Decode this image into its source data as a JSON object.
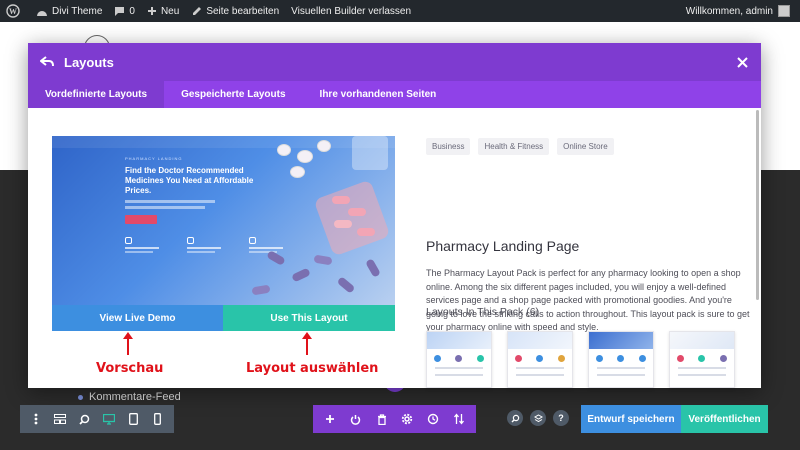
{
  "adminbar": {
    "site_name": "Divi Theme",
    "comments_count": "0",
    "new_label": "Neu",
    "edit_page": "Seite bearbeiten",
    "exit_builder": "Visuellen Builder verlassen",
    "welcome": "Willkommen, admin"
  },
  "modal": {
    "title": "Layouts",
    "tabs": [
      {
        "label": "Vordefinierte Layouts",
        "active": true
      },
      {
        "label": "Gespeicherte Layouts",
        "active": false
      },
      {
        "label": "Ihre vorhandenen Seiten",
        "active": false
      }
    ],
    "preview": {
      "kicker": "PHARMACY LANDING",
      "headline": "Find the Doctor Recommended Medicines You Need at Affordable Prices."
    },
    "view_demo_label": "View Live Demo",
    "use_layout_label": "Use This Layout",
    "tags": [
      "Business",
      "Health & Fitness",
      "Online Store"
    ],
    "layout_name": "Pharmacy Landing Page",
    "description": "The Pharmacy Layout Pack is perfect for any pharmacy looking to open a shop online. Among the six different pages included, you will enjoy a well-defined services page and a shop page packed with promotional goodies. And you're going to love the striking calls to action throughout. This layout pack is sure to get your pharmacy online with speed and style.",
    "pack_title": "Layouts In This Pack (6)"
  },
  "annotations": {
    "preview_label": "Vorschau",
    "select_label": "Layout auswählen"
  },
  "page": {
    "feed_link": "Kommentare-Feed"
  },
  "builder_bar": {
    "save_draft": "Entwurf speichern",
    "publish": "Veröffentlichen"
  },
  "colors": {
    "purple_header": "#7e3bd0",
    "purple_tabs": "#8f42e8",
    "blue_button": "#3d8fe0",
    "teal_button": "#29c4a9",
    "annotation_red": "#e0121a"
  }
}
